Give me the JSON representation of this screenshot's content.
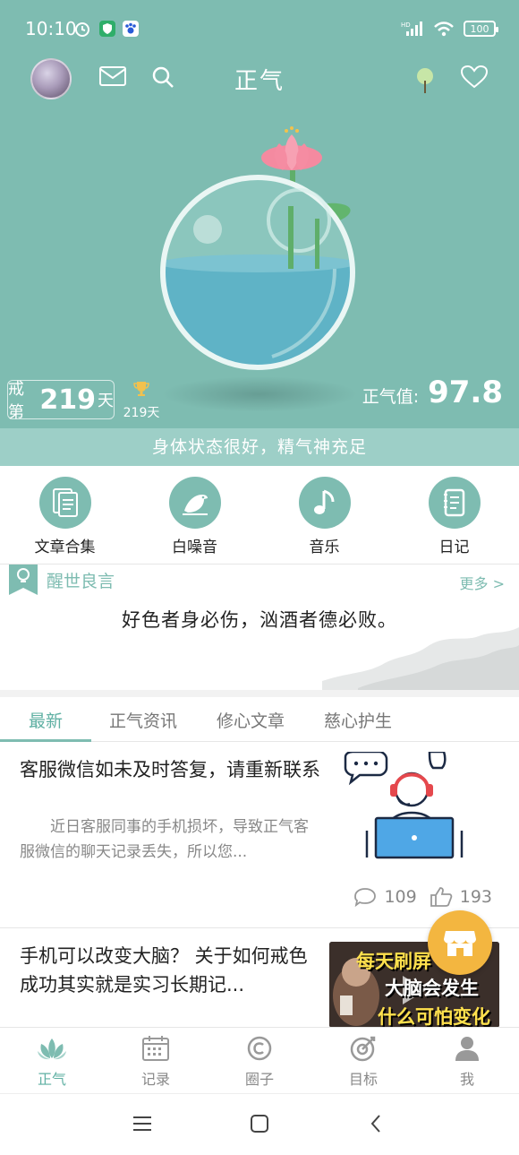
{
  "status": {
    "time": "10:10",
    "network": "HD",
    "battery": "100"
  },
  "header": {
    "title": "正气"
  },
  "hero": {
    "jie_prefix": "戒第",
    "jie_days": "219",
    "jie_suffix": "天",
    "trophy_days": "219天",
    "zhengqi_label": "正气值:",
    "zhengqi_value": "97.8",
    "state_text": "身体状态很好，精气神充足"
  },
  "quick_nav": [
    {
      "label": "文章合集",
      "icon": "documents-icon"
    },
    {
      "label": "白噪音",
      "icon": "bird-icon"
    },
    {
      "label": "音乐",
      "icon": "music-note-icon"
    },
    {
      "label": "日记",
      "icon": "diary-icon"
    }
  ],
  "quote": {
    "title": "醒世良言",
    "more": "更多 >",
    "text": "好色者身必伤，汹酒者德必败。"
  },
  "tabs": [
    {
      "label": "最新",
      "active": true
    },
    {
      "label": "正气资讯",
      "active": false
    },
    {
      "label": "修心文章",
      "active": false
    },
    {
      "label": "慈心护生",
      "active": false
    }
  ],
  "articles": [
    {
      "title": "客服微信如未及时答复，请重新联系",
      "summary": "近日客服同事的手机损坏，导致正气客服微信的聊天记录丢失，所以您...",
      "comments": "109",
      "likes": "193"
    },
    {
      "title": "手机可以改变大脑？ 关于如何戒色成功其实就是实习长期记...",
      "thumb_line1": "每天刷屏",
      "thumb_line2": "大脑会发生",
      "thumb_line3": "什么可怕变化"
    }
  ],
  "bottom_nav": [
    {
      "label": "正气",
      "icon": "lotus-icon",
      "active": true
    },
    {
      "label": "记录",
      "icon": "calendar-icon",
      "active": false
    },
    {
      "label": "圈子",
      "icon": "circle-icon",
      "active": false
    },
    {
      "label": "目标",
      "icon": "target-icon",
      "active": false
    },
    {
      "label": "我",
      "icon": "person-icon",
      "active": false
    }
  ],
  "colors": {
    "accent": "#7ebcb1",
    "accent_dark": "#5fb0a3",
    "fab": "#f3b640"
  }
}
